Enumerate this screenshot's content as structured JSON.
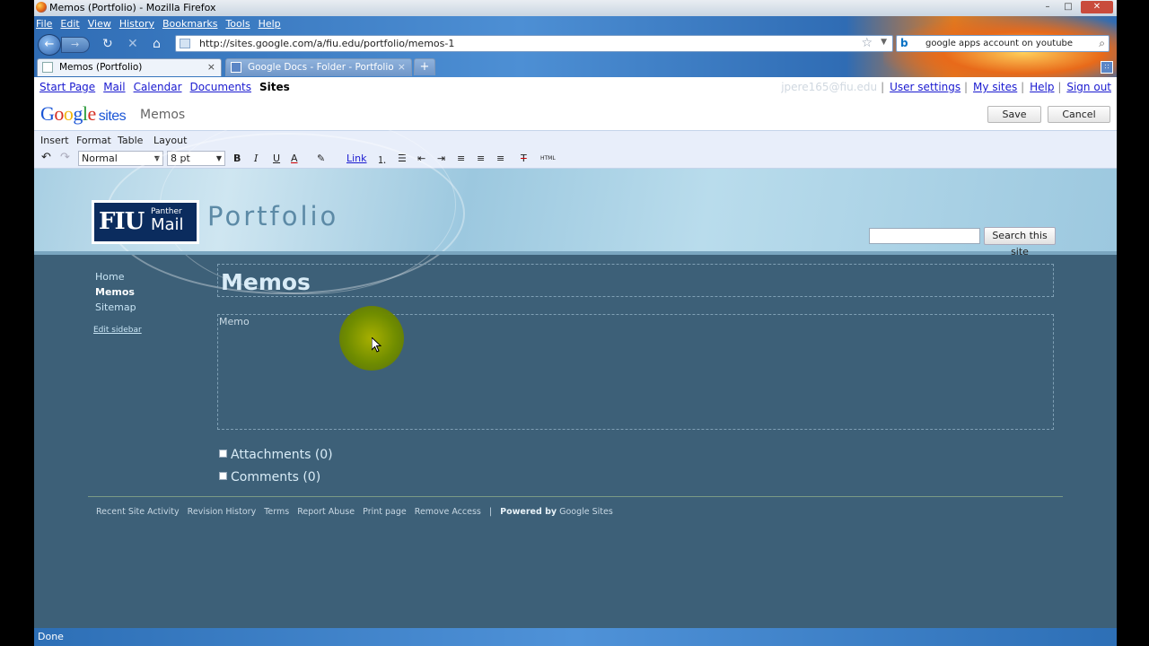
{
  "window": {
    "title": "Memos (Portfolio) - Mozilla Firefox",
    "min_glyph": "–",
    "max_glyph": "□",
    "close_glyph": "✕"
  },
  "menubar": [
    "File",
    "Edit",
    "View",
    "History",
    "Bookmarks",
    "Tools",
    "Help"
  ],
  "nav": {
    "back_glyph": "←",
    "forward_glyph": "→",
    "reload_glyph": "↻",
    "stop_glyph": "✕",
    "home_glyph": "⌂",
    "url": "http://sites.google.com/a/fiu.edu/portfolio/memos-1",
    "star_glyph": "☆",
    "search_engine": "b",
    "search_query": "google apps account on youtube",
    "search_glyph": "⌕"
  },
  "tabs": [
    {
      "label": "Memos (Portfolio)",
      "active": true
    },
    {
      "label": "Google Docs - Folder - Portfolio",
      "active": false
    }
  ],
  "tab_close_glyph": "×",
  "new_tab_glyph": "+",
  "tab_list_glyph": "∷",
  "gbar": {
    "links": [
      "Start Page",
      "Mail",
      "Calendar",
      "Documents"
    ],
    "current": "Sites",
    "email": "jpere165@fiu.edu",
    "separator": "|",
    "right_links": [
      "User settings",
      "My sites",
      "Help",
      "Sign out"
    ]
  },
  "header": {
    "logo_letters": [
      "G",
      "o",
      "o",
      "g",
      "l",
      "e"
    ],
    "logo_suffix": "sites",
    "page_name": "Memos",
    "save": "Save",
    "cancel": "Cancel"
  },
  "editor_menu": [
    "Insert",
    "Format",
    "Table",
    "Layout"
  ],
  "toolbar": {
    "undo_glyph": "↶",
    "redo_glyph": "↷",
    "style": "Normal",
    "size": "8 pt",
    "select_arrow": "▼",
    "bold": "B",
    "italic": "I",
    "underline": "U",
    "text_color": "A",
    "highlight_glyph": "✎",
    "link": "Link",
    "numbered_glyph": "⒈",
    "bulleted_glyph": "☰",
    "outdent_glyph": "⇤",
    "indent_glyph": "⇥",
    "align_left_glyph": "≡",
    "align_center_glyph": "≡",
    "align_right_glyph": "≡",
    "clear_format": "T",
    "html": "HTML"
  },
  "site": {
    "logo_main": "FIU",
    "logo_small": "Panther",
    "logo_mail": "Mail",
    "title": "Portfolio",
    "search_button": "Search this site"
  },
  "sidebar": {
    "items": [
      {
        "label": "Home",
        "current": false
      },
      {
        "label": "Memos",
        "current": true
      },
      {
        "label": "Sitemap",
        "current": false
      }
    ],
    "edit": "Edit sidebar"
  },
  "page": {
    "title": "Memos",
    "body": "Memo",
    "attachments": "Attachments (0)",
    "comments": "Comments (0)"
  },
  "footer": {
    "links": [
      "Recent Site Activity",
      "Revision History",
      "Terms",
      "Report Abuse",
      "Print page",
      "Remove Access"
    ],
    "separator": "|",
    "powered_bold": "Powered by",
    "powered_rest": "Google Sites"
  },
  "status": "Done",
  "colors": {
    "content_bg": "#3d6078",
    "link_blue": "#1a1ad0",
    "cursor_halo": "#8a9e00"
  }
}
